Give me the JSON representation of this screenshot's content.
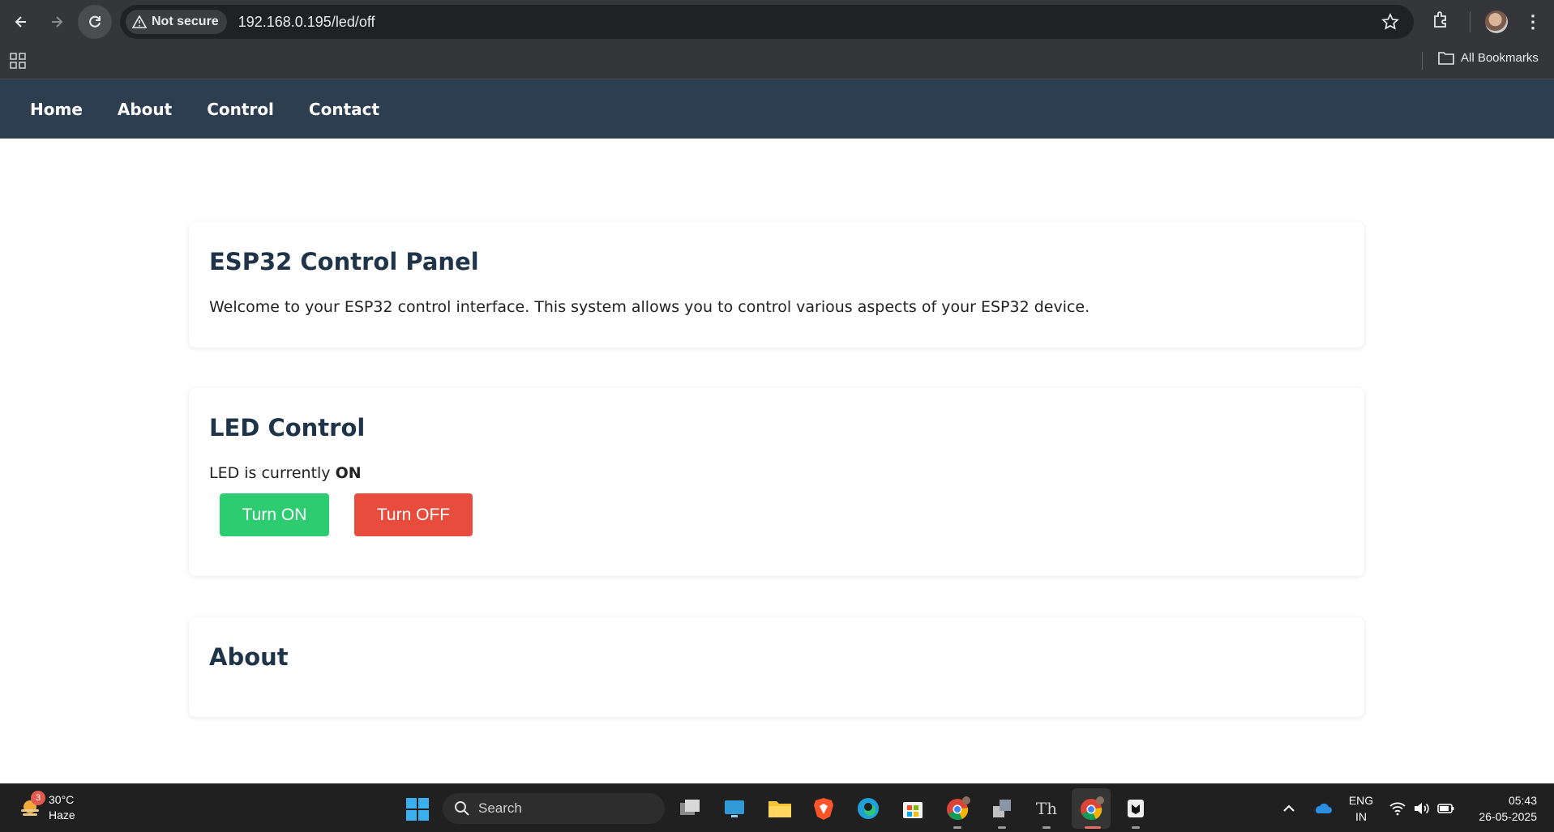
{
  "browser": {
    "security_label": "Not secure",
    "url": "192.168.0.195/led/off",
    "bookmarks_label": "All Bookmarks"
  },
  "site_nav": {
    "items": [
      {
        "label": "Home"
      },
      {
        "label": "About"
      },
      {
        "label": "Control"
      },
      {
        "label": "Contact"
      }
    ]
  },
  "panel": {
    "title": "ESP32 Control Panel",
    "description": "Welcome to your ESP32 control interface. This system allows you to control various aspects of your ESP32 device."
  },
  "led": {
    "title": "LED Control",
    "status_prefix": "LED is currently ",
    "status_value": "ON",
    "on_button": "Turn ON",
    "off_button": "Turn OFF",
    "on_color": "#2ecc71",
    "off_color": "#e74c3c"
  },
  "about": {
    "title": "About"
  },
  "taskbar": {
    "weather_badge": "3",
    "weather_temp": "30°C",
    "weather_desc": "Haze",
    "search_placeholder": "Search",
    "language": "ENG",
    "region": "IN",
    "time": "05:43",
    "date": "26-05-2025"
  },
  "colors": {
    "nav_bg": "#2c3e50",
    "heading": "#1f3448"
  }
}
